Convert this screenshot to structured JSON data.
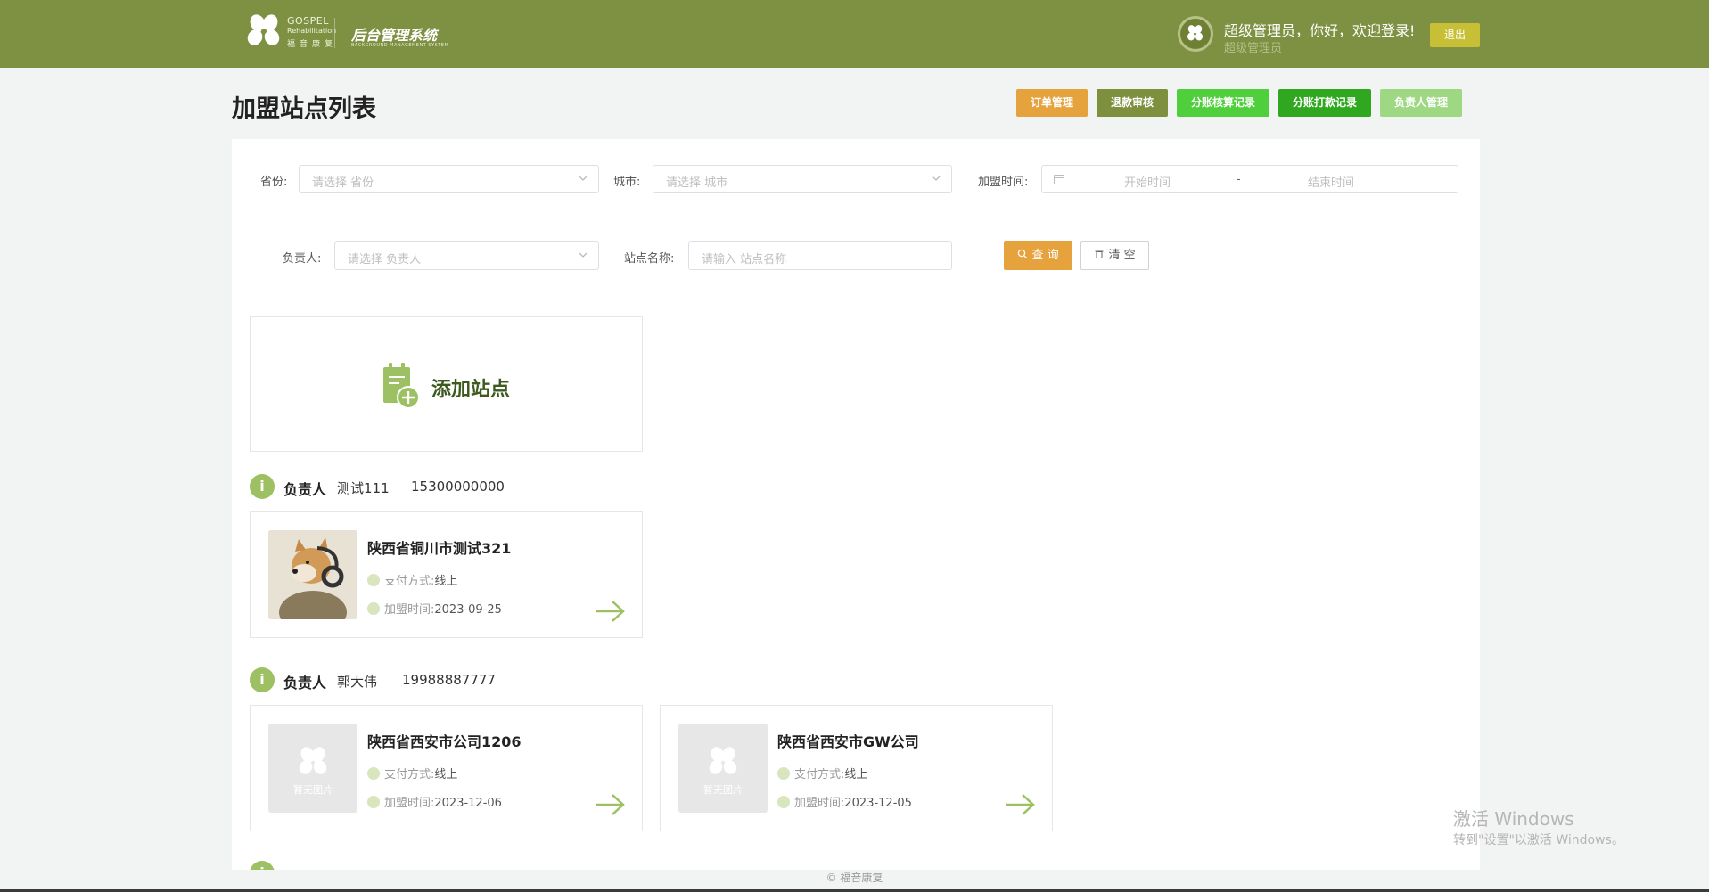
{
  "header": {
    "logo_en": "GOSPEL",
    "logo_en_sub": "Rehabilitation",
    "logo_cn": "福音康复",
    "system_title": "后台管理系统",
    "system_subtitle": "BACKGROUND MANAGEMENT SYSTEM",
    "greeting": "超级管理员，你好，欢迎登录!",
    "role": "超级管理员",
    "logout_label": "退出"
  },
  "page": {
    "title": "加盟站点列表"
  },
  "toolbar": {
    "buttons": [
      {
        "label": "订单管理",
        "color": "#e6a23c"
      },
      {
        "label": "退款审核",
        "color": "#7e8f3e"
      },
      {
        "label": "分账核算记录",
        "color": "#4fcf3b"
      },
      {
        "label": "分账打款记录",
        "color": "#2fa81f"
      },
      {
        "label": "负责人管理",
        "color": "#9ed883"
      }
    ]
  },
  "filters": {
    "province": {
      "label": "省份:",
      "placeholder": "请选择 省份"
    },
    "city": {
      "label": "城市:",
      "placeholder": "请选择 城市"
    },
    "join_time": {
      "label": "加盟时间:",
      "start_placeholder": "开始时间",
      "separator": "-",
      "end_placeholder": "结束时间"
    },
    "manager": {
      "label": "负责人:",
      "placeholder": "请选择 负责人"
    },
    "site_name": {
      "label": "站点名称:",
      "placeholder": "请输入 站点名称"
    },
    "query_label": "查 询",
    "clear_label": "清 空"
  },
  "add_site": {
    "label": "添加站点"
  },
  "groups": [
    {
      "tag": "负责人",
      "name": "测试111",
      "phone": "15300000000",
      "sites": [
        {
          "name": "陕西省铜川市测试321",
          "pay_label": "支付方式:",
          "pay_value": "线上",
          "time_label": "加盟时间:",
          "time_value": "2023-09-25"
        }
      ]
    },
    {
      "tag": "负责人",
      "name": "郭大伟",
      "phone": "19988887777",
      "sites": [
        {
          "name": "陕西省西安市公司1206",
          "pay_label": "支付方式:",
          "pay_value": "线上",
          "time_label": "加盟时间:",
          "time_value": "2023-12-06",
          "no_image": "暂无图片"
        },
        {
          "name": "陕西省西安市GW公司",
          "pay_label": "支付方式:",
          "pay_value": "线上",
          "time_label": "加盟时间:",
          "time_value": "2023-12-05",
          "no_image": "暂无图片"
        }
      ]
    }
  ],
  "footer": {
    "copyright": "© 福音康复"
  },
  "watermark": {
    "line1": "激活 Windows",
    "line2": "转到\"设置\"以激活 Windows。"
  }
}
